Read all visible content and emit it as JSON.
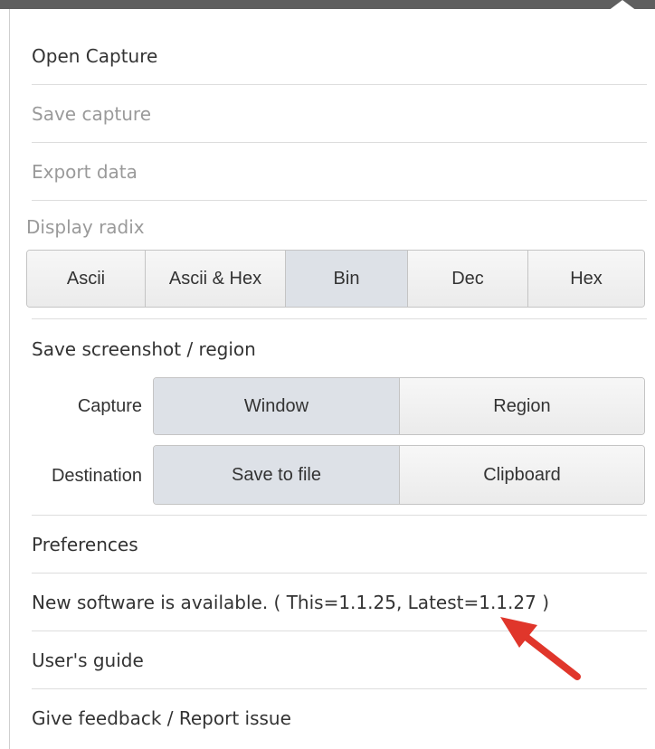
{
  "menu": {
    "open_capture": "Open Capture",
    "save_capture": "Save capture",
    "export_data": "Export data",
    "display_radix": {
      "label": "Display radix",
      "options": [
        "Ascii",
        "Ascii & Hex",
        "Bin",
        "Dec",
        "Hex"
      ],
      "selected": "Bin"
    },
    "screenshot": {
      "title": "Save screenshot / region",
      "capture_label": "Capture",
      "capture_options": [
        "Window",
        "Region"
      ],
      "capture_selected": "Window",
      "destination_label": "Destination",
      "destination_options": [
        "Save to file",
        "Clipboard"
      ],
      "destination_selected": "Save to file"
    },
    "preferences": "Preferences",
    "update_notice": "New software is available. ( This=1.1.25, Latest=1.1.27 )",
    "users_guide": "User's guide",
    "feedback": "Give feedback / Report issue"
  },
  "colors": {
    "annotation_arrow": "#e0362b",
    "selected_button": "#dde1e7",
    "disabled_text": "#9a9a9a"
  }
}
